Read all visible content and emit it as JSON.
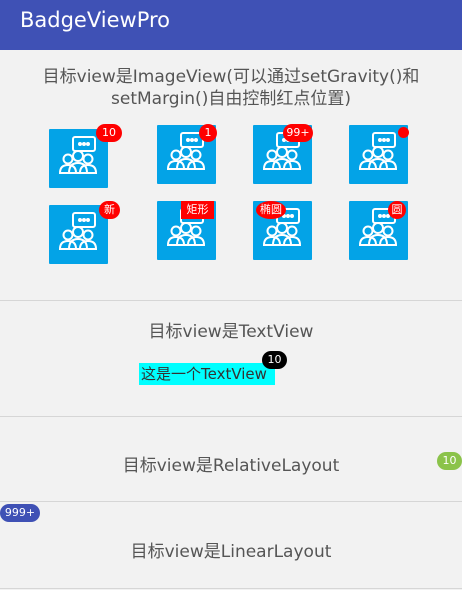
{
  "appbar": {
    "title": "BadgeViewPro"
  },
  "section1": {
    "title_line1": "目标view是ImageView(可以通过setGravity()和",
    "title_line2": "setMargin()自由控制红点位置)",
    "badges": [
      "10",
      "1",
      "99+",
      "",
      "新",
      "矩形",
      "椭圆",
      "圆"
    ]
  },
  "section2": {
    "title": "目标view是TextView",
    "text": "这是一个TextView",
    "badge": "10"
  },
  "section3": {
    "title": "目标view是RelativeLayout",
    "badge": "10"
  },
  "section4": {
    "title": "目标view是LinearLayout",
    "badge": "999+"
  },
  "colors": {
    "appbar": "#3f51b5",
    "tile": "#03a3e7",
    "badge_red": "#ff0000",
    "badge_green": "#8bc34a",
    "textview_bg": "#00ffff"
  }
}
